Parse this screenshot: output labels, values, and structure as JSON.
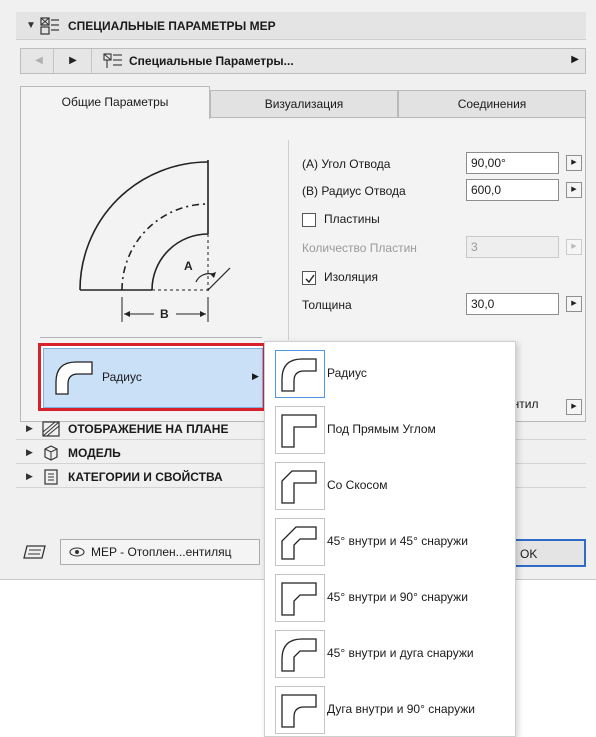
{
  "section": {
    "title": "СПЕЦИАЛЬНЫЕ ПАРАМЕТРЫ MEP"
  },
  "nav": {
    "title": "Специальные Параметры..."
  },
  "tabs": [
    {
      "label": "Общие Параметры",
      "active": true
    },
    {
      "label": "Визуализация",
      "active": false
    },
    {
      "label": "Соединения",
      "active": false
    }
  ],
  "diagram": {
    "label_a": "A",
    "label_b": "B"
  },
  "params": {
    "angle": {
      "label": "(A) Угол Отвода",
      "value": "90,00°"
    },
    "radius": {
      "label": "(B) Радиус Отвода",
      "value": "600,0"
    },
    "plates": {
      "label": "Пластины",
      "checked": false
    },
    "plate_count": {
      "label": "Количество Пластин",
      "value": "3",
      "disabled": true
    },
    "insulation": {
      "label": "Изоляция",
      "checked": true
    },
    "thickness": {
      "label": "Толщина",
      "value": "30,0"
    }
  },
  "shape_select": {
    "label": "Радиус"
  },
  "partial_text": "ентил",
  "sections": [
    {
      "title": "ОТОБРАЖЕНИЕ НА ПЛАНЕ",
      "icon": "floor-plan-icon"
    },
    {
      "title": "МОДЕЛЬ",
      "icon": "cube-icon"
    },
    {
      "title": "КАТЕГОРИИ И СВОЙСТВА",
      "icon": "list-icon"
    }
  ],
  "footer": {
    "layer": "MEP - Отоплен...ентиляц",
    "ok": "OK"
  },
  "dropdown": {
    "options": [
      {
        "label": "Радиус",
        "icon": "radius-elbow-icon",
        "selected": true
      },
      {
        "label": "Под Прямым Углом",
        "icon": "right-angle-elbow-icon",
        "selected": false
      },
      {
        "label": "Со Скосом",
        "icon": "bevel-elbow-icon",
        "selected": false
      },
      {
        "label": "45° внутри и 45° снаружи",
        "icon": "45-in-45-out-elbow-icon",
        "selected": false
      },
      {
        "label": "45° внутри и 90° снаружи",
        "icon": "45-in-90-out-elbow-icon",
        "selected": false
      },
      {
        "label": "45° внутри и дуга снаружи",
        "icon": "45-in-arc-out-elbow-icon",
        "selected": false
      },
      {
        "label": "Дуга внутри и 90° снаружи",
        "icon": "arc-in-90-out-elbow-icon",
        "selected": false
      }
    ]
  },
  "colors": {
    "selection_border": "#d7222b",
    "selection_fill": "#c9e0f7",
    "ok_border": "#2e6bc6"
  }
}
